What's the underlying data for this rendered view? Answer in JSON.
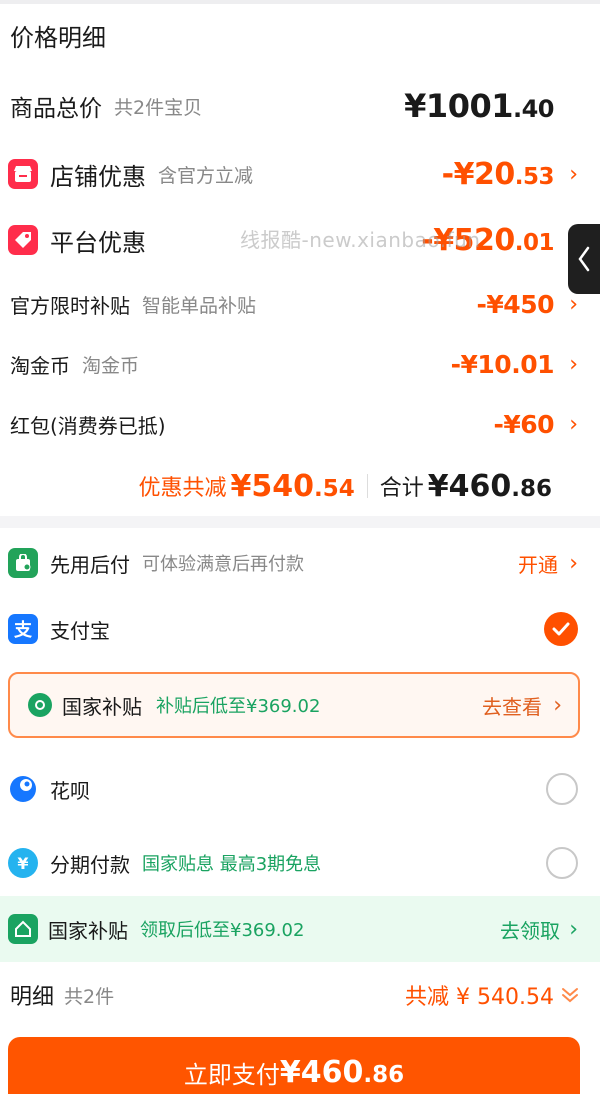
{
  "header": {
    "title": "价格明细"
  },
  "total": {
    "label": "商品总价",
    "count": "共2件宝贝",
    "price_int": "¥1001",
    "price_dec": ".40"
  },
  "shop_discount": {
    "label": "店铺优惠",
    "sub": "含官方立减",
    "price_int": "-¥20",
    "price_dec": ".53"
  },
  "platform_discount": {
    "label": "平台优惠",
    "price_int": "-¥520",
    "price_dec": ".01"
  },
  "watermark": "线报酷-new.xianbao.fun",
  "official_subsidy": {
    "label": "官方限时补贴",
    "sub": "智能单品补贴",
    "price": "-¥450"
  },
  "taojinbi": {
    "label": "淘金币",
    "sub": "淘金币",
    "price": "-¥10.01"
  },
  "red_packet": {
    "label": "红包(消费券已抵)",
    "price": "-¥60"
  },
  "summary": {
    "discount_label": "优惠共减",
    "discount_int": "¥540",
    "discount_dec": ".54",
    "total_label": "合计",
    "total_int": "¥460",
    "total_dec": ".86"
  },
  "pay_later": {
    "label": "先用后付",
    "sub": "可体验满意后再付款",
    "action": "开通"
  },
  "alipay": {
    "label": "支付宝"
  },
  "subsidy_box": {
    "label": "国家补贴",
    "sub": "补贴后低至¥369.02",
    "action": "去查看"
  },
  "huabei": {
    "label": "花呗"
  },
  "installment": {
    "label": "分期付款",
    "sub": "国家贴息 最高3期免息"
  },
  "subsidy_band": {
    "label": "国家补贴",
    "sub": "领取后低至¥369.02",
    "action": "去领取"
  },
  "detail": {
    "label": "明细",
    "count": "共2件",
    "saving": "共减 ¥ 540.54"
  },
  "pay_button": {
    "label": "立即支付",
    "price_int": "¥460",
    "price_dec": ".86"
  },
  "colors": {
    "accent": "#ff5000",
    "green": "#1aa361",
    "button": "#ff5500"
  }
}
